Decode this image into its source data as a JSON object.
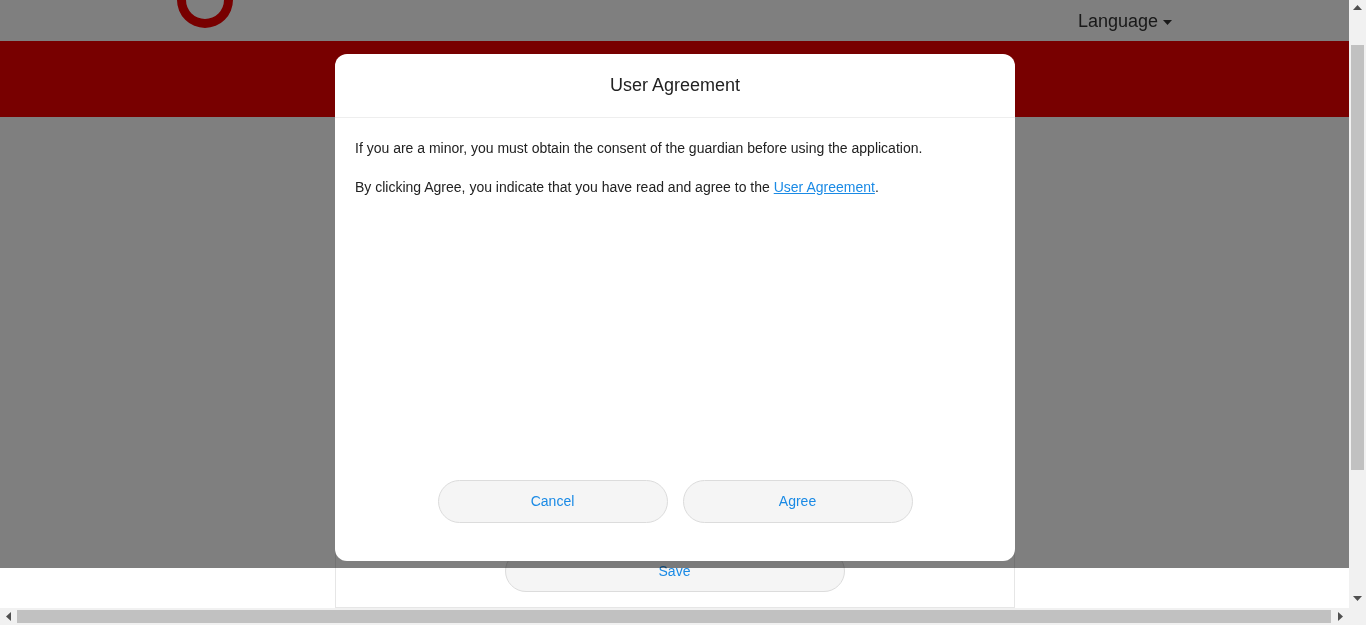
{
  "header": {
    "language_menu": "Language"
  },
  "page": {
    "save_button": "Save"
  },
  "dialog": {
    "title": "User Agreement",
    "minor_notice": "If you are a minor, you must obtain the consent of the guardian before using the application.",
    "agreement_text": {
      "before": "By clicking Agree, you indicate that you have read and agree to the ",
      "link": "User Agreement",
      "after": "."
    },
    "cancel_button": "Cancel",
    "agree_button": "Agree"
  }
}
